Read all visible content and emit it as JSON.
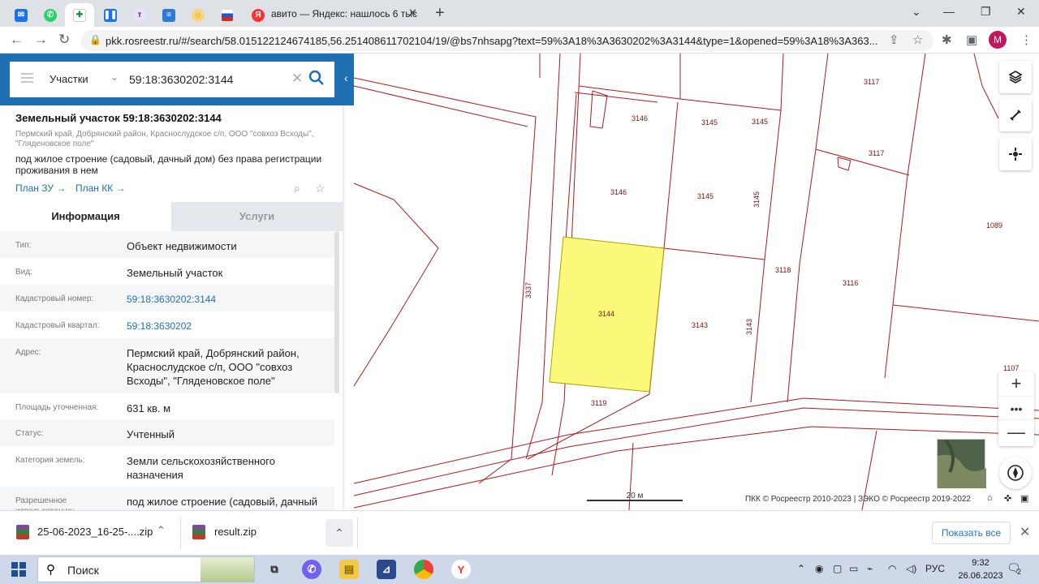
{
  "browser": {
    "tabs": [
      {
        "name": "mail"
      },
      {
        "name": "whatsapp"
      },
      {
        "name": "docs",
        "active": true
      },
      {
        "name": "pause"
      },
      {
        "name": "t-app"
      },
      {
        "name": "sheets"
      },
      {
        "name": "sun"
      },
      {
        "name": "flag"
      }
    ],
    "active_tab": {
      "title": "авито — Яндекс: нашлось 6 тыс"
    },
    "url": "pkk.rosreestr.ru/#/search/58.015122124674185,56.251408611702104/19/@bs7nhsapg?text=59%3A18%3A3630202%3A3144&type=1&opened=59%3A18%3A363...",
    "avatar": "M"
  },
  "search": {
    "type_label": "Участки",
    "query": "59:18:3630202:3144"
  },
  "parcel": {
    "title": "Земельный участок 59:18:3630202:3144",
    "address_short": "Пермский край, Добрянский район, Краснослудское с/п, ООО \"совхоз Всходы\", \"Гляденовское поле\"",
    "use": "под жилое строение (садовый, дачный дом) без права регистрации проживания в нем",
    "link_zu": "План ЗУ →",
    "link_kk": "План КК →"
  },
  "info_tabs": {
    "info": "Информация",
    "services": "Услуги"
  },
  "rows": [
    {
      "k": "Тип:",
      "v": "Объект недвижимости"
    },
    {
      "k": "Вид:",
      "v": "Земельный участок"
    },
    {
      "k": "Кадастровый номер:",
      "v": "59:18:3630202:3144"
    },
    {
      "k": "Кадастровый квартал:",
      "v": "59:18:3630202"
    },
    {
      "k": "Адрес:",
      "v": "Пермский край, Добрянский район, Краснослудское с/п, ООО \"совхоз Всходы\", \"Гляденовское поле\""
    },
    {
      "k": "Площадь уточненная:",
      "v": "631 кв. м"
    },
    {
      "k": "Статус:",
      "v": "Учтенный"
    },
    {
      "k": "Категория земель:",
      "v": "Земли сельскохозяйственного назначения"
    },
    {
      "k": "Разрешенное использование:",
      "v": "под жилое строение (садовый, дачный"
    }
  ],
  "map": {
    "labels": {
      "l3146a": "3146",
      "l3145a": "3145",
      "l3145b": "3145",
      "l3117a": "3117",
      "l3117b": "3117",
      "l3146b": "3146",
      "l3145c": "3145",
      "l3145d": "3145",
      "l1089": "1089",
      "l3118": "3118",
      "l3116": "3116",
      "l3337": "3337",
      "l3144": "3144",
      "l3143a": "3143",
      "l3143b": "3143",
      "l1107": "1107",
      "l3119": "3119"
    },
    "scale_label": "20 м",
    "attribution": "ПКК © Росреестр 2010-2023 | ЗЭКО © Росреестр 2019-2022",
    "selected_fill": "#fbf87a",
    "border_color": "#b0191e"
  },
  "downloads": {
    "items": [
      "25-06-2023_16-25-....zip",
      "result.zip"
    ],
    "show_all": "Показать все"
  },
  "taskbar": {
    "search": "Поиск",
    "lang": "РУС",
    "time": "9:32",
    "date": "26.06.2023",
    "notif_count": "2"
  }
}
